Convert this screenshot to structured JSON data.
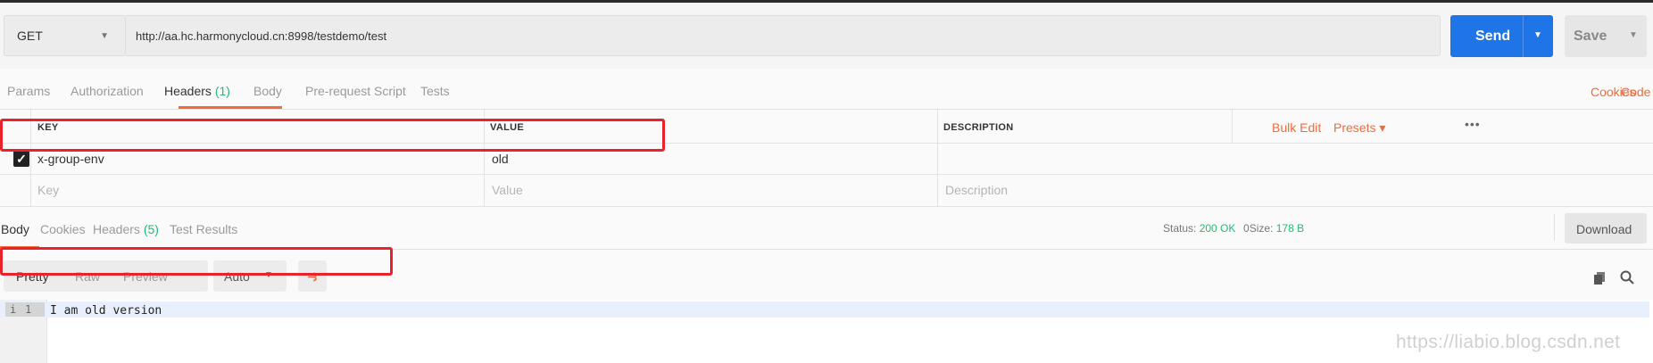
{
  "request": {
    "method": "GET",
    "url": "http://aa.hc.harmonycloud.cn:8998/testdemo/test",
    "send_label": "Send",
    "save_label": "Save"
  },
  "request_tabs": [
    {
      "label": "Params"
    },
    {
      "label": "Authorization"
    },
    {
      "label": "Headers",
      "count": "(1)"
    },
    {
      "label": "Body"
    },
    {
      "label": "Pre-request Script"
    },
    {
      "label": "Tests"
    }
  ],
  "request_links": {
    "cookies": "Cookies",
    "code": "Code"
  },
  "headers_table": {
    "columns": [
      "KEY",
      "VALUE",
      "DESCRIPTION"
    ],
    "actions": {
      "more": "•••",
      "bulk_edit": "Bulk Edit",
      "presets": "Presets ▾"
    },
    "rows": [
      {
        "checked": true,
        "key": "x-group-env",
        "value": "old",
        "description": ""
      }
    ],
    "placeholders": {
      "key": "Key",
      "value": "Value",
      "description": "Description"
    }
  },
  "response_tabs": [
    {
      "label": "Body"
    },
    {
      "label": "Cookies"
    },
    {
      "label": "Headers",
      "count": "(5)"
    },
    {
      "label": "Test Results"
    }
  ],
  "response_status": {
    "status_label": "Status:",
    "status_value": "200 OK",
    "time_label": "0",
    "size_label": "Size:",
    "size_value": "178 B",
    "download_label": "Download"
  },
  "body_view": {
    "modes": [
      "Pretty",
      "Raw",
      "Preview"
    ],
    "active_mode": "Pretty",
    "format": "Auto",
    "wrap_icon": "wrap-lines-icon"
  },
  "editor": {
    "line_marker": "i",
    "line_number": "1",
    "content": "I am old version"
  },
  "watermark": "https://liabio.blog.csdn.net",
  "colors": {
    "accent": "#f26b3a",
    "send": "#1f74e8",
    "success": "#2bb673",
    "highlight": "#e8232b"
  }
}
